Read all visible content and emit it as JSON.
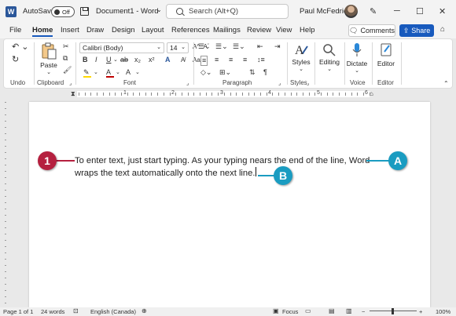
{
  "titlebar": {
    "app_icon": "W",
    "autosave_label": "AutoSave",
    "autosave_state": "Off",
    "document_name": "Document1",
    "separator": "-",
    "app_name": "Word",
    "search_placeholder": "Search (Alt+Q)",
    "user_name": "Paul McFedries"
  },
  "menu": {
    "items": [
      "File",
      "Home",
      "Insert",
      "Draw",
      "Design",
      "Layout",
      "References",
      "Mailings",
      "Review",
      "View",
      "Help"
    ],
    "active": "Home",
    "comments_label": "Comments",
    "share_label": "Share"
  },
  "ribbon": {
    "groups": [
      "Undo",
      "Clipboard",
      "Font",
      "Paragraph",
      "Styles",
      "Voice",
      "Editor"
    ],
    "paste_label": "Paste",
    "font_name": "Calibri (Body)",
    "font_size": "14",
    "styles_label": "Styles",
    "editing_label": "Editing",
    "dictate_label": "Dictate",
    "editor_label": "Editor",
    "font_buttons": [
      "B",
      "I",
      "U",
      "ab",
      "x₂",
      "x²",
      "A"
    ],
    "grow_font": "A^",
    "shrink_font": "Aˇ",
    "case_button": "Aa",
    "clear_format": "A"
  },
  "ruler": {
    "numbers": [
      "1",
      "2",
      "3",
      "4",
      "5",
      "6"
    ]
  },
  "document": {
    "line1": "To enter text, just start typing. As your typing nears the end of the line, Word",
    "line2": "wraps the text automatically onto the next line."
  },
  "callouts": [
    {
      "label": "1",
      "color": "#b5203f"
    },
    {
      "label": "A",
      "color": "#1a9cc1"
    },
    {
      "label": "B",
      "color": "#1a9cc1"
    }
  ],
  "status": {
    "page": "Page 1 of 1",
    "words": "24 words",
    "language": "English (Canada)",
    "focus": "Focus",
    "zoom": "100%"
  },
  "colors": {
    "accent": "#185abd",
    "word_blue": "#2b579a",
    "highlight": "#ffd800",
    "font_color": "#c00000"
  }
}
